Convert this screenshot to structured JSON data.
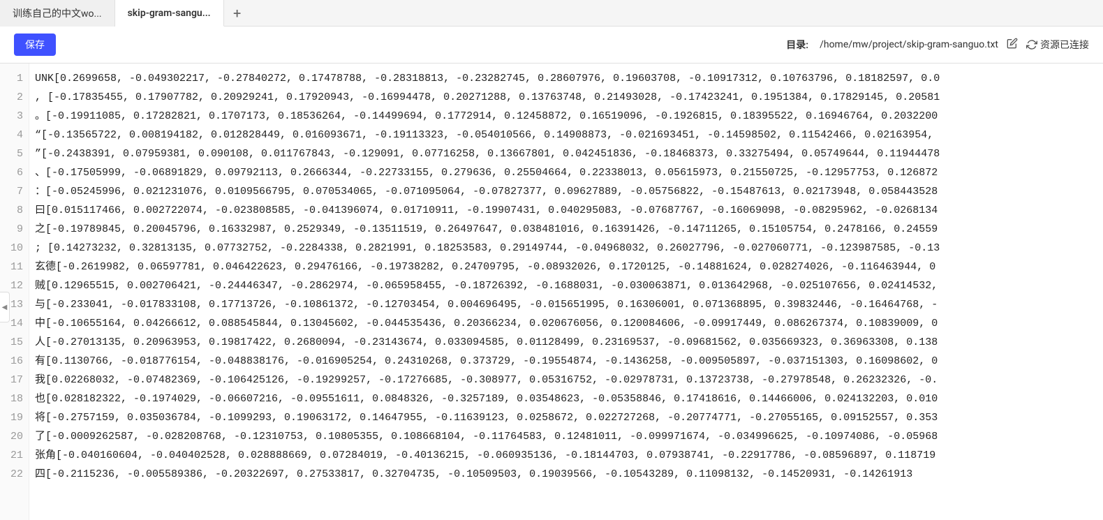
{
  "tabs": [
    {
      "label": "训练自己的中文wo...",
      "active": false
    },
    {
      "label": "skip-gram-sangu...",
      "active": true
    }
  ],
  "toolbar": {
    "save_label": "保存",
    "path_label": "目录:",
    "path_value": "/home/mw/project/skip-gram-sanguo.txt",
    "status_label": "资源已连接"
  },
  "editor": {
    "lines": [
      "UNK[0.2699658, -0.049302217, -0.27840272, 0.17478788, -0.28318813, -0.23282745, 0.28607976, 0.19603708, -0.10917312, 0.10763796, 0.18182597, 0.0",
      ", [-0.17835455, 0.17907782, 0.20929241, 0.17920943, -0.16994478, 0.20271288, 0.13763748, 0.21493028, -0.17423241, 0.1951384, 0.17829145, 0.20581",
      "。[-0.19911085, 0.17282821, 0.1707173, 0.18536264, -0.14499694, 0.1772914, 0.12458872, 0.16519096, -0.1926815, 0.18395522, 0.16946764, 0.2032200",
      "“[-0.13565722, 0.008194182, 0.012828449, 0.016093671, -0.19113323, -0.054010566, 0.14908873, -0.021693451, -0.14598502, 0.11542466, 0.02163954, ",
      "”[-0.2438391, 0.07959381, 0.090108, 0.011767843, -0.129091, 0.07716258, 0.13667801, 0.042451836, -0.18468373, 0.33275494, 0.05749644, 0.11944478",
      "、[-0.17505999, -0.06891829, 0.09792113, 0.2666344, -0.22733155, 0.279636, 0.25504664, 0.22338013, 0.05615973, 0.21550725, -0.12957753, 0.126872",
      "：[-0.05245996, 0.021231076, 0.0109566795, 0.070534065, -0.071095064, -0.07827377, 0.09627889, -0.05756822, -0.15487613, 0.02173948, 0.058443528",
      "曰[0.015117466, 0.002722074, -0.023808585, -0.041396074, 0.01710911, -0.19907431, 0.040295083, -0.07687767, -0.16069098, -0.08295962, -0.0268134",
      "之[-0.19789845, 0.20045796, 0.16332987, 0.2529349, -0.13511519, 0.26497647, 0.038481016, 0.16391426, -0.14711265, 0.15105754, 0.2478166, 0.24559",
      "; [0.14273232, 0.32813135, 0.07732752, -0.2284338, 0.2821991, 0.18253583, 0.29149744, -0.04968032, 0.26027796, -0.027060771, -0.123987585, -0.13",
      "玄德[-0.2619982, 0.06597781, 0.046422623, 0.29476166, -0.19738282, 0.24709795, -0.08932026, 0.1720125, -0.14881624, 0.028274026, -0.116463944, 0",
      "贼[0.12965515, 0.002706421, -0.24446347, -0.2862974, -0.065958455, -0.18726392, -0.1688031, -0.030063871, 0.013642968, -0.025107656, 0.02414532, ",
      "与[-0.233041, -0.017833108, 0.17713726, -0.10861372, -0.12703454, 0.004696495, -0.015651995, 0.16306001, 0.071368895, 0.39832446, -0.16464768, -",
      "中[-0.10655164, 0.04266612, 0.088545844, 0.13045602, -0.044535436, 0.20366234, 0.020676056, 0.120084606, -0.09917449, 0.086267374, 0.10839009, 0",
      "人[-0.27013135, 0.20963953, 0.19817422, 0.2680094, -0.23143674, 0.033094585, 0.01128499, 0.23169537, -0.09681562, 0.035669323, 0.36963308, 0.138",
      "有[0.1130766, -0.018776154, -0.048838176, -0.016905254, 0.24310268, 0.373729, -0.19554874, -0.1436258, -0.009505897, -0.037151303, 0.16098602, 0",
      "我[0.02268032, -0.07482369, -0.106425126, -0.19299257, -0.17276685, -0.308977, 0.05316752, -0.02978731, 0.13723738, -0.27978548, 0.26232326, -0.",
      "也[0.028182322, -0.1974029, -0.06607216, -0.09551611, 0.0848326, -0.3257189, 0.03548623, -0.05358846, 0.17418616, 0.14466006, 0.024132203, 0.010",
      "将[-0.2757159, 0.035036784, -0.1099293, 0.19063172, 0.14647955, -0.11639123, 0.0258672, 0.022727268, -0.20774771, -0.27055165, 0.09152557, 0.353",
      "了[-0.0009262587, -0.028208768, -0.12310753, 0.10805355, 0.108668104, -0.11764583, 0.12481011, -0.099971674, -0.034996625, -0.10974086, -0.05968",
      "张角[-0.040160604, -0.040402528, 0.028888669, 0.07284019, -0.40136215, -0.060935136, -0.18144703, 0.07938741, -0.22917786, -0.08596897, 0.118719",
      "四[-0.2115236, -0.005589386, -0.20322697, 0.27533817, 0.32704735, -0.10509503, 0.19039566, -0.10543289, 0.11098132, -0.14520931, -0.14261913"
    ]
  }
}
